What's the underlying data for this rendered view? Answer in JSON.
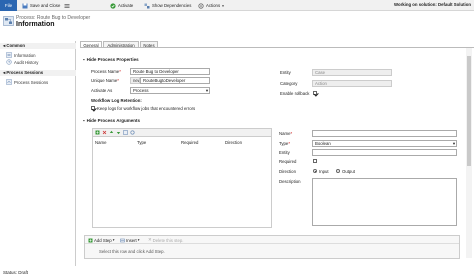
{
  "toolbar": {
    "file_label": "File",
    "save_close_label": "Save and Close",
    "activate_label": "Activate",
    "show_dependencies_label": "Show Dependencies",
    "actions_label": "Actions",
    "solution_text": "Working on solution: Default Solution"
  },
  "header": {
    "breadcrumb": "Process: Route Bug to Developer",
    "title": "Information"
  },
  "nav": {
    "common_header": "Common",
    "common_items": [
      {
        "label": "Information"
      },
      {
        "label": "Audit History"
      }
    ],
    "sessions_header": "Process Sessions",
    "session_items": [
      {
        "label": "Process Sessions"
      }
    ]
  },
  "tabs": [
    {
      "label": "General"
    },
    {
      "label": "Administration"
    },
    {
      "label": "Notes"
    }
  ],
  "properties": {
    "section_title": "Hide Process Properties",
    "process_name_label": "Process Name",
    "process_name_value": "Route Bug to Developer",
    "unique_name_label": "Unique Name",
    "unique_name_prefix": "new_",
    "unique_name_value": "RouteBugtoDeveloper",
    "activate_as_label": "Activate As",
    "activate_as_value": "Process",
    "entity_label": "Entity",
    "entity_value": "Case",
    "category_label": "Category",
    "category_value": "Action",
    "rollback_label": "Enable rollback",
    "rollback_checked": true
  },
  "retention": {
    "title": "Workflow Log Retention",
    "keep_logs_label": "Keep logs for workflow jobs that encountered errors",
    "keep_logs_checked": true
  },
  "arguments": {
    "section_title": "Hide Process Arguments",
    "columns": [
      "Name",
      "Type",
      "Required",
      "Direction"
    ],
    "rows": []
  },
  "arg_detail": {
    "name_label": "Name",
    "name_value": "",
    "type_label": "Type",
    "type_value": "Boolean",
    "entity_label": "Entity",
    "entity_value": "",
    "required_label": "Required",
    "required_checked": false,
    "direction_label": "Direction",
    "direction_options": [
      "Input",
      "Output"
    ],
    "direction_selected": "Input",
    "description_label": "Description"
  },
  "steps": {
    "add_step_label": "Add Step",
    "insert_label": "Insert",
    "delete_label": "Delete this step.",
    "hint": "Select this row and click Add Step."
  },
  "status": {
    "text": "Status: Draft"
  },
  "colors": {
    "file_tab": "#2b66b1",
    "required": "#cc0000"
  }
}
